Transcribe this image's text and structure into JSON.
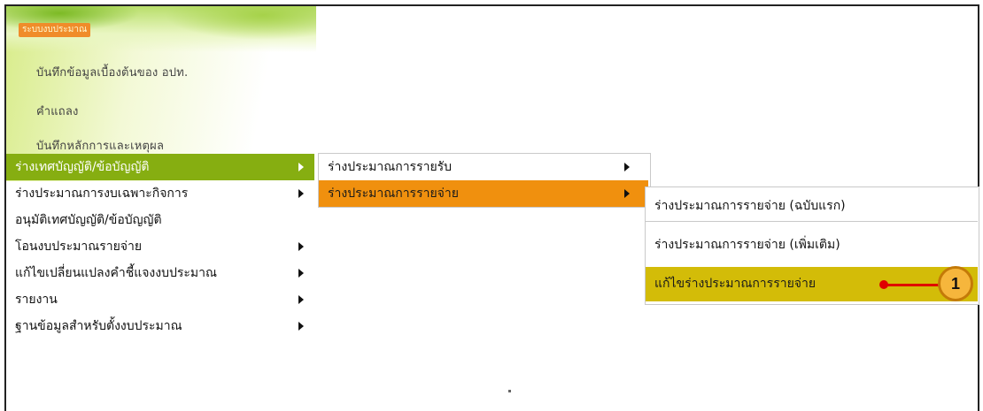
{
  "banner": {
    "title": "ระบบงบประมาณ",
    "items": [
      "บันทึกข้อมูลเบื้องต้นของ อปท.",
      "คำแถลง",
      "บันทึกหลักการและเหตุผล"
    ]
  },
  "menu_l1": [
    {
      "label": "ร่างเทศบัญญัติ/ข้อบัญญัติ",
      "arrow": true
    },
    {
      "label": "ร่างประมาณการงบเฉพาะกิจการ",
      "arrow": true
    },
    {
      "label": "อนุมัติเทศบัญญัติ/ข้อบัญญัติ",
      "arrow": false
    },
    {
      "label": "โอนงบประมาณรายจ่าย",
      "arrow": true
    },
    {
      "label": "แก้ไขเปลี่ยนแปลงคำชี้แจงงบประมาณ",
      "arrow": true
    },
    {
      "label": "รายงาน",
      "arrow": true
    },
    {
      "label": "ฐานข้อมูลสำหรับตั้งงบประมาณ",
      "arrow": true
    }
  ],
  "menu_l2": [
    {
      "label": "ร่างประมาณการรายรับ",
      "arrow": true
    },
    {
      "label": "ร่างประมาณการรายจ่าย",
      "arrow": true
    }
  ],
  "menu_l3": [
    {
      "label": "ร่างประมาณการรายจ่าย (ฉบับแรก)"
    },
    {
      "label": "ร่างประมาณการรายจ่าย (เพิ่มเติม)"
    },
    {
      "label": "แก้ไขร่างประมาณการรายจ่าย"
    }
  ],
  "callout": {
    "number": "1"
  },
  "colors": {
    "level1_selected": "#86ae11",
    "level2_selected": "#f0900e",
    "level3_selected": "#d3bc08",
    "callout": "#e00000"
  }
}
